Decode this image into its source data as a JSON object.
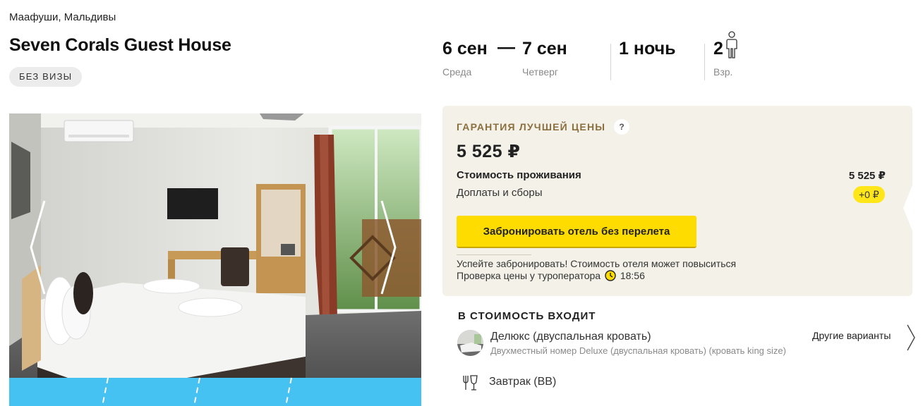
{
  "location": "Маафуши, Мальдивы",
  "hotel_name": "Seven Corals Guest House",
  "visa_badge": "БЕЗ ВИЗЫ",
  "dates": {
    "check_in": "6 сен",
    "check_in_day": "Среда",
    "separator": "—",
    "check_out": "7 сен",
    "check_out_day": "Четверг",
    "nights": "1 ночь",
    "guests": "2",
    "guests_label": "Взр."
  },
  "icons": {
    "person": "person-icon",
    "help": "question-mark-icon",
    "clock": "clock-icon",
    "meal": "fork-and-glass-icon",
    "chevron": "chevron-right-icon"
  },
  "price_card": {
    "guarantee": "ГАРАНТИЯ ЛУЧШЕЙ ЦЕНЫ",
    "help_label": "?",
    "total": "5 525 ₽",
    "stay_label": "Стоимость проживания",
    "stay_value": "5 525 ₽",
    "fees_label": "Доплаты и сборы",
    "fees_value": "+0 ₽",
    "book_button": "Забронировать отель без перелета",
    "urge_text": "Успейте забронировать! Стоимость отеля может повыситься",
    "check_text": "Проверка цены у туроператора",
    "check_time": "18:56"
  },
  "included": {
    "title": "В СТОИМОСТЬ ВХОДИТ",
    "room_name": "Делюкс (двуспальная кровать)",
    "room_desc": "Двухместный номер Deluxe (двуспальная кровать) (кровать king size)",
    "other_options": "Другие варианты",
    "meal": "Завтрак (BB)"
  },
  "colors": {
    "accent_yellow": "#ffdc00",
    "card_bg": "#f3f1e8",
    "guarantee_gold": "#8b6f3e"
  }
}
